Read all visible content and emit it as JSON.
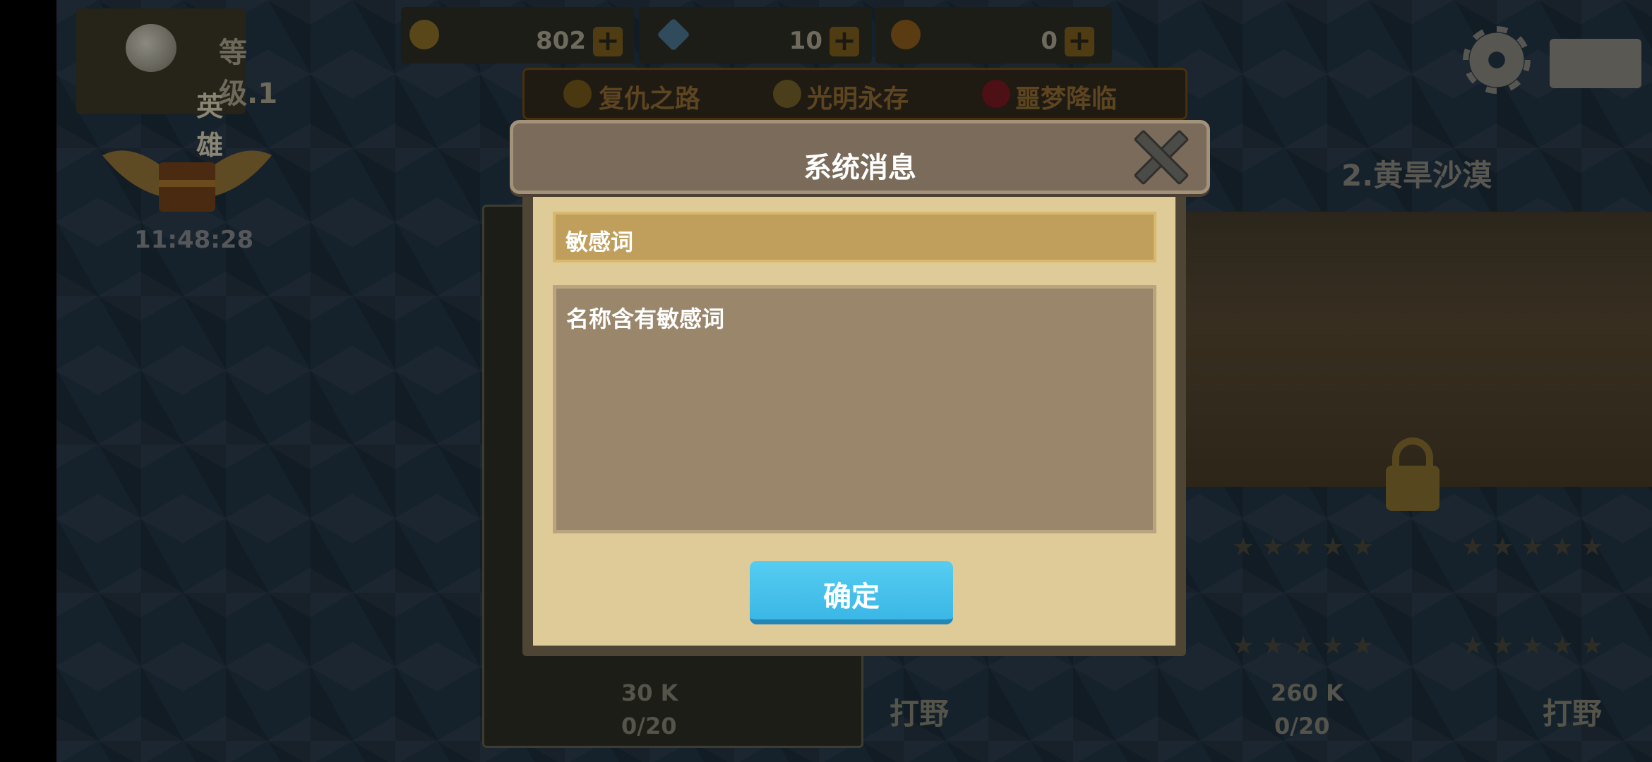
{
  "player": {
    "level_label": "等级.1",
    "rank_label": "英雄"
  },
  "resources": [
    {
      "icon": "gold-coin-icon",
      "value": "802"
    },
    {
      "icon": "diamond-icon",
      "value": "10"
    },
    {
      "icon": "orange-orb-icon",
      "value": "0"
    }
  ],
  "tabs": [
    {
      "label": "复仇之路",
      "icon": "shield-icon"
    },
    {
      "label": "光明永存",
      "icon": "shield-icon"
    },
    {
      "label": "噩梦降临",
      "icon": "alert-icon"
    }
  ],
  "chest": {
    "timer": "11:48:28"
  },
  "maps": {
    "second_title": "2.黄旱沙漠",
    "left_card": {
      "gold": "30 K",
      "stars": "0/20",
      "action": "打野"
    },
    "right_card": {
      "gold": "260 K",
      "stars": "0/20",
      "action": "打野"
    }
  },
  "dialog": {
    "title": "系统消息",
    "subject": "敏感词",
    "message": "名称含有敏感词",
    "confirm_label": "确定"
  },
  "colors": {
    "dialog_header": "#7a6b5a",
    "dialog_body": "#dfcb98",
    "subject_bar": "#c09f5c",
    "message_box": "#9a866b",
    "confirm_button": "#3bb7e6"
  }
}
